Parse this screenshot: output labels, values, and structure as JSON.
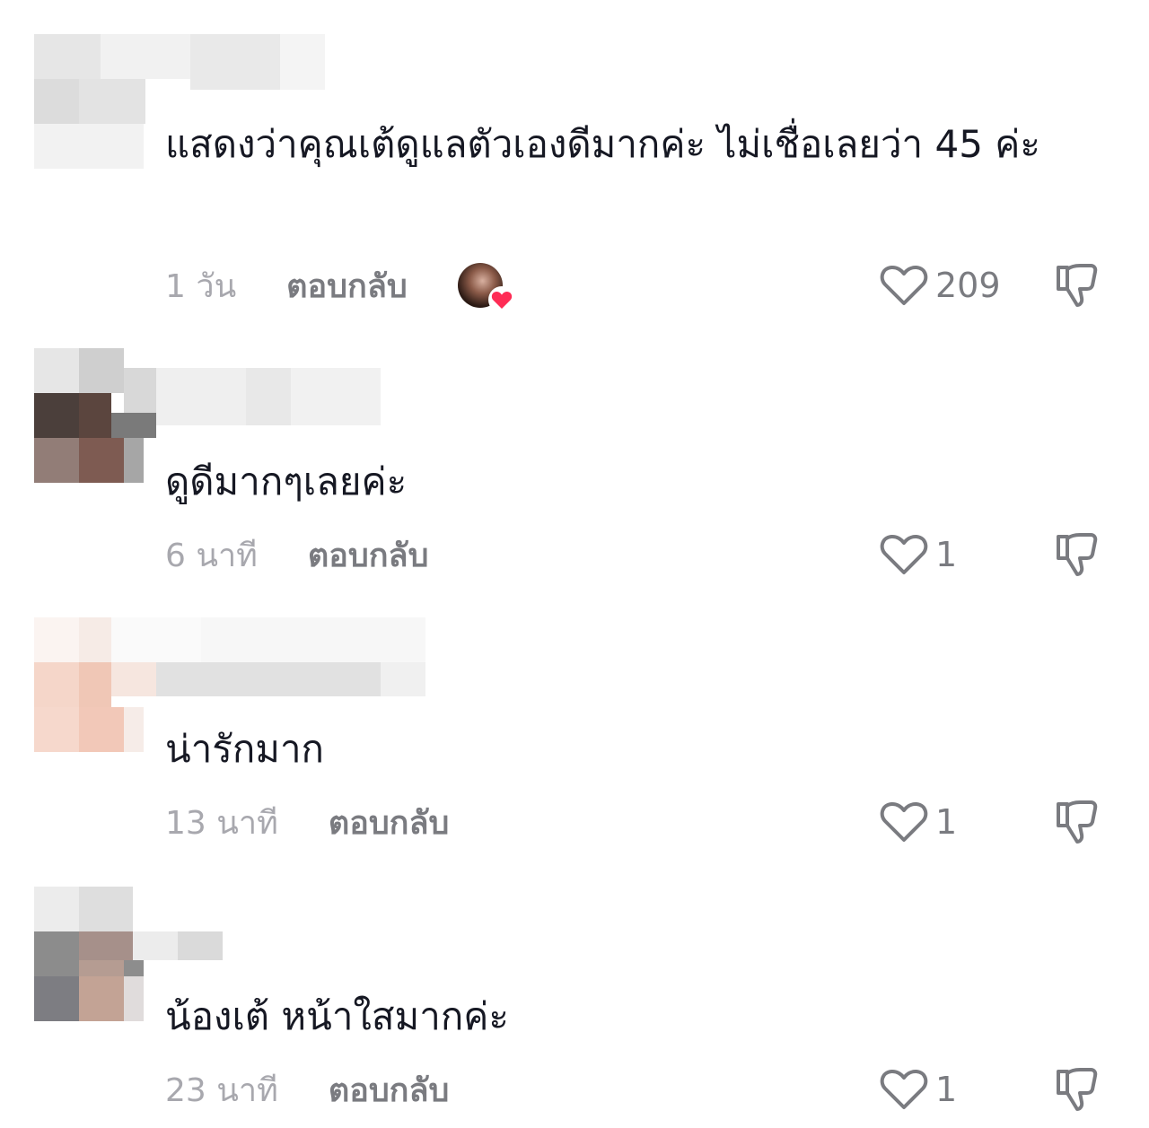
{
  "colors": {
    "text_primary": "#161823",
    "text_muted": "#a8a8ae",
    "reply": "#7a7b80",
    "heart_badge": "#fe2c55"
  },
  "icons": {
    "like": "heart-outline-icon",
    "dislike": "thumbs-down-outline-icon",
    "creator_liked": "heart-filled-icon"
  },
  "comments": [
    {
      "text": "แสดงว่าคุณเต้ดูแลตัวเองดีมากค่ะ ไม่เชื่อเลยว่า 45 ค่ะ",
      "time": "1 วัน",
      "reply_label": "ตอบกลับ",
      "likes": "209",
      "creator_liked": true
    },
    {
      "text": "ดูดีมากๆเลยค่ะ",
      "time": "6 นาที",
      "reply_label": "ตอบกลับ",
      "likes": "1",
      "creator_liked": false
    },
    {
      "text": "น่ารักมาก",
      "time": "13 นาที",
      "reply_label": "ตอบกลับ",
      "likes": "1",
      "creator_liked": false
    },
    {
      "text": "น้องเต้ หน้าใสมากค่ะ",
      "time": "23 นาที",
      "reply_label": "ตอบกลับ",
      "likes": "1",
      "creator_liked": false
    }
  ]
}
